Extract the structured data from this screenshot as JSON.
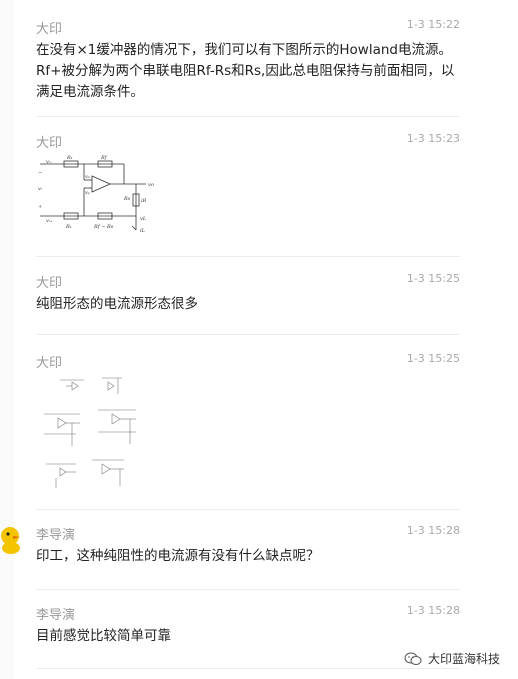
{
  "messages": [
    {
      "sender": "大印",
      "time": "1-3 15:22",
      "text": "在没有×1缓冲器的情况下，我们可以有下图所示的Howland电流源。Rf+被分解为两个串联电阻Rf-Rs和Rs,因此总电阻保持与前面相同，以满足电流源条件。"
    },
    {
      "sender": "大印",
      "time": "1-3 15:23",
      "figure": {
        "labels": {
          "v_minus": "v₋",
          "v_plus": "+",
          "minus": "−",
          "vi": "vᵢ",
          "r1_top": "R₁",
          "rf_top": "Rf",
          "r1_bot": "R₁",
          "rf_rs": "Rf − Rs",
          "rs": "Rs",
          "vo": "vo",
          "vl": "vL",
          "il": "iL",
          "ir": "iR",
          "rl": "RL",
          "in_plus": "vᵢ₊",
          "in_minus": "vᵢ₋",
          "vp": "vₚ",
          "vn": "vₙ"
        }
      }
    },
    {
      "sender": "大印",
      "time": "1-3 15:25",
      "text": "纯阻形态的电流源形态很多"
    },
    {
      "sender": "大印",
      "time": "1-3 15:25",
      "figure": {
        "type": "circuit-collage"
      }
    },
    {
      "sender": "李导演",
      "time": "1-3 15:28",
      "text": "印工，这种纯阻性的电流源有没有什么缺点呢？"
    },
    {
      "sender": "李导演",
      "time": "1-3 15:28",
      "text": "目前感觉比较简单可靠"
    }
  ],
  "watermark": {
    "label": "大印蓝海科技",
    "icon": "wechat-icon"
  },
  "colors": {
    "sender": "#9a9a9a",
    "time": "#a8a8a8",
    "separator": "#ececec"
  }
}
